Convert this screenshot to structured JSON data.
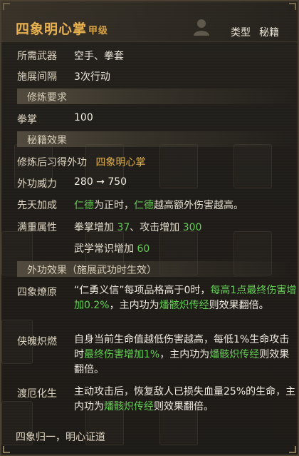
{
  "header": {
    "title": "四象明心掌",
    "grade": "甲级",
    "type_label": "类型",
    "type_value": "秘籍"
  },
  "basic": {
    "weapon_label": "所需武器",
    "weapon_value": "空手、拳套",
    "interval_label": "施展间隔",
    "interval_value": "3次行动"
  },
  "training": {
    "section_title": "修炼要求",
    "req_label": "拳掌",
    "req_value": "100"
  },
  "effects": {
    "section_title": "秘籍效果",
    "learn_label": "修炼后习得外功",
    "learn_value": "四象明心掌",
    "power_label": "外功威力",
    "power_value": "280 → 750",
    "innate_label": "先天加成",
    "innate_p1": "仁德",
    "innate_p2": "为正时，",
    "innate_p3": "仁德",
    "innate_p4": "越高额外伤害越高。",
    "full_label": "满重属性",
    "full_1a": "拳掌增加 ",
    "full_1b": "37",
    "full_1c": "、攻击增加 ",
    "full_1d": "300",
    "full_2a": "武学常识增加 ",
    "full_2b": "60"
  },
  "external": {
    "section_title": "外功效果（施展武功时生效）",
    "e1_label": "四象燎原",
    "e1_p1": "“仁勇义信”每项品格高于0时，",
    "e1_p2": "每高1点最终伤害增加0.2%",
    "e1_p3": "，主内功为",
    "e1_p4": "燔骸炽传经",
    "e1_p5": "则效果翻倍。",
    "e2_label": "侠魄炽燃",
    "e2_p1": "自身当前生命值越低伤害越高，每低1%生命攻击时",
    "e2_p2": "最终伤害增加1%",
    "e2_p3": "，主内功为",
    "e2_p4": "燔骸炽传经",
    "e2_p5": "则效果翻倍。",
    "e3_label": "渡厄化生",
    "e3_p1": "主动攻击后，恢复敌人已损失血量25%的生命，主内功为",
    "e3_p2": "燔骸炽传经",
    "e3_p3": "则效果翻倍。"
  },
  "footer": {
    "text": "四象归一，明心证道"
  },
  "colors": {
    "title_gold": "#e8b04e",
    "highlight_green": "#62cf52",
    "background": "#1f1c18"
  }
}
